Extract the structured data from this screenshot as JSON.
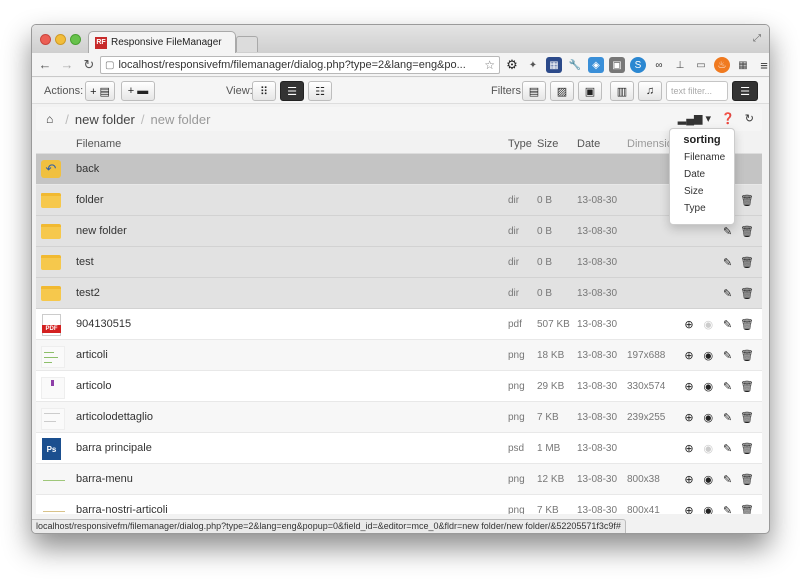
{
  "browser": {
    "tab_title": "Responsive FileManager",
    "tab_favicon": "RF",
    "url": "localhost/responsivefm/filemanager/dialog.php?type=2&lang=eng&po...",
    "status_url": "localhost/responsivefm/filemanager/dialog.php?type=2&lang=eng&popup=0&field_id=&editor=mce_0&fldr=new folder/new folder/&52205571f3c9f#"
  },
  "toolbar": {
    "actions_label": "Actions:",
    "upload_label": "+ ▤",
    "new_folder_label": "+ ▬",
    "view_label": "View:",
    "filters_label": "Filters:",
    "filter_placeholder": "text filter..."
  },
  "breadcrumb": {
    "items": [
      "new folder"
    ],
    "current": "new folder"
  },
  "sorting": {
    "title": "sorting",
    "options": [
      "Filename",
      "Date",
      "Size",
      "Type"
    ]
  },
  "list": {
    "headers": {
      "filename": "Filename",
      "type": "Type",
      "size": "Size",
      "date": "Date",
      "dimension": "Dimension"
    },
    "back_label": "back",
    "dirs": [
      {
        "name": "folder",
        "type": "dir",
        "size": "0 B",
        "date": "13-08-30"
      },
      {
        "name": "new folder",
        "type": "dir",
        "size": "0 B",
        "date": "13-08-30"
      },
      {
        "name": "test",
        "type": "dir",
        "size": "0 B",
        "date": "13-08-30"
      },
      {
        "name": "test2",
        "type": "dir",
        "size": "0 B",
        "date": "13-08-30"
      }
    ],
    "files": [
      {
        "name": "904130515",
        "type": "pdf",
        "size": "507 KB",
        "date": "13-08-30",
        "dim": ""
      },
      {
        "name": "articoli",
        "type": "png",
        "size": "18 KB",
        "date": "13-08-30",
        "dim": "197x688"
      },
      {
        "name": "articolo",
        "type": "png",
        "size": "29 KB",
        "date": "13-08-30",
        "dim": "330x574"
      },
      {
        "name": "articolodettaglio",
        "type": "png",
        "size": "7 KB",
        "date": "13-08-30",
        "dim": "239x255"
      },
      {
        "name": "barra principale",
        "type": "psd",
        "size": "1 MB",
        "date": "13-08-30",
        "dim": ""
      },
      {
        "name": "barra-menu",
        "type": "png",
        "size": "12 KB",
        "date": "13-08-30",
        "dim": "800x38"
      },
      {
        "name": "barra-nostri-articoli",
        "type": "png",
        "size": "7 KB",
        "date": "13-08-30",
        "dim": "800x41"
      }
    ]
  },
  "colors": {
    "accent": "#333333",
    "folder": "#f6c84c",
    "pdf_band": "#d32020",
    "psd": "#1b4f8f"
  }
}
